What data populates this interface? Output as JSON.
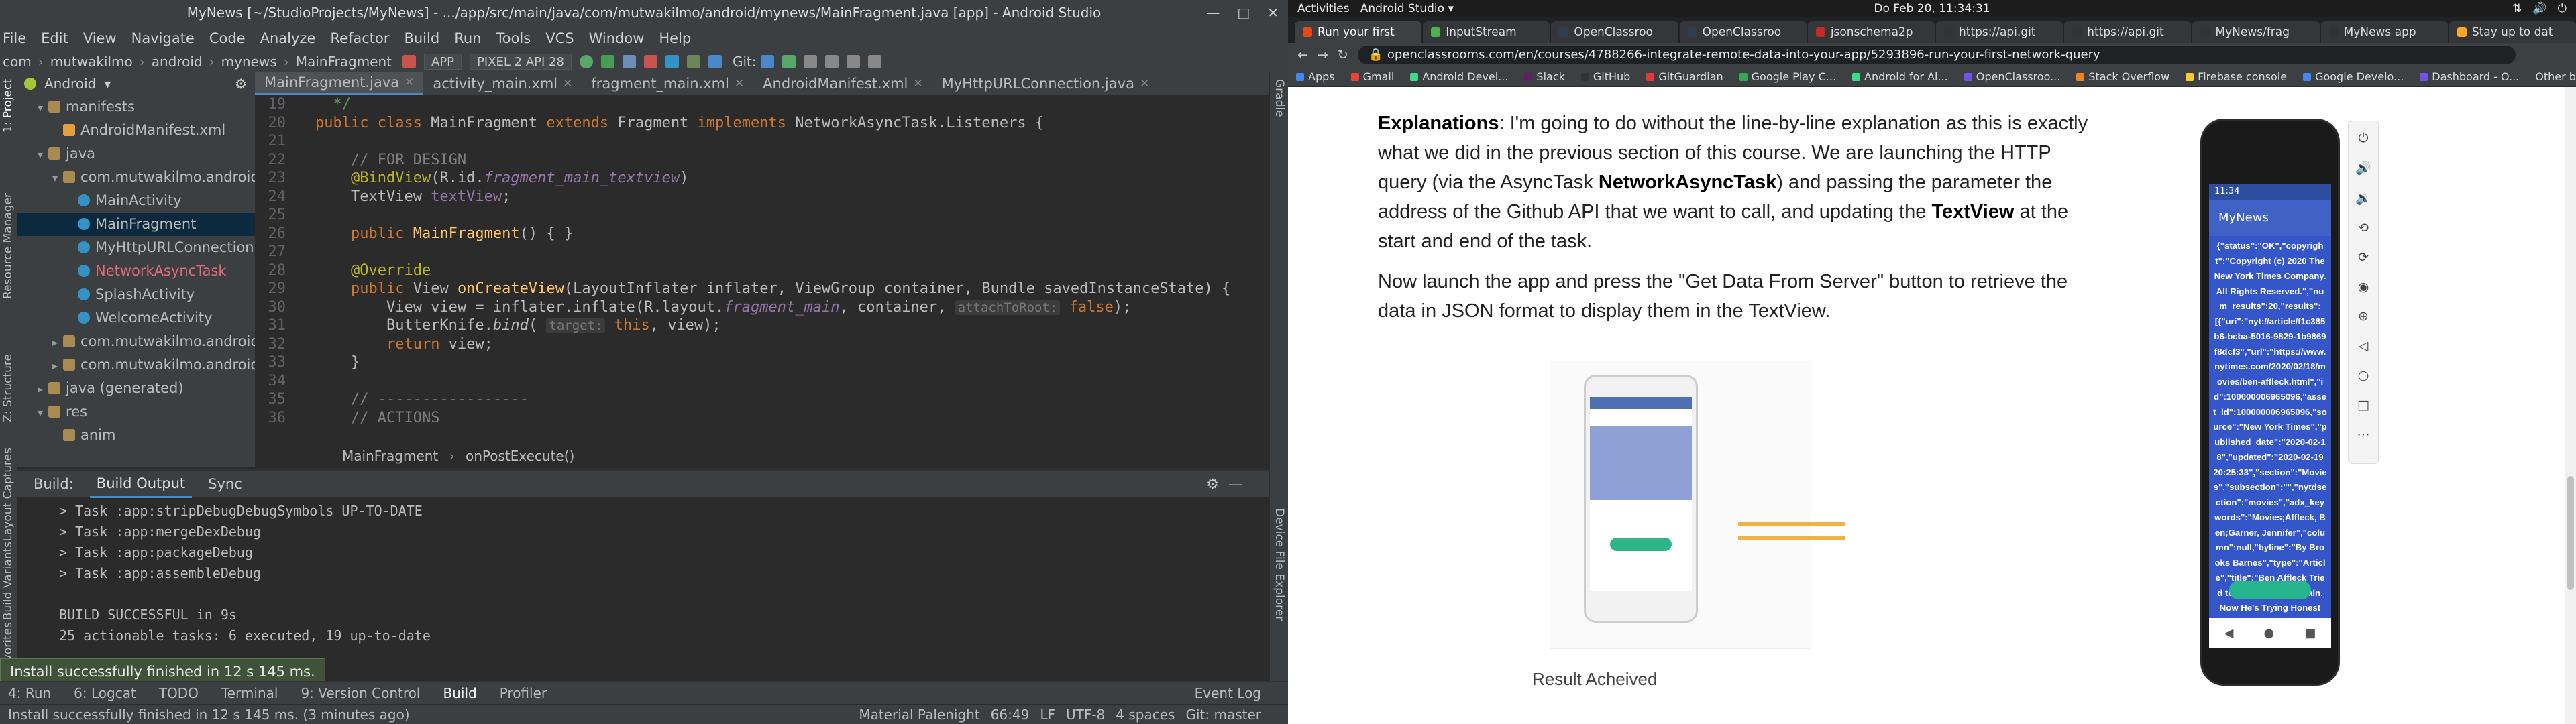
{
  "android_studio": {
    "title": "MyNews [~/StudioProjects/MyNews] - .../app/src/main/java/com/mutwakilmo/android/mynews/MainFragment.java [app] - Android Studio",
    "menu": [
      "File",
      "Edit",
      "View",
      "Navigate",
      "Code",
      "Analyze",
      "Refactor",
      "Build",
      "Run",
      "Tools",
      "VCS",
      "Window",
      "Help"
    ],
    "nav": {
      "crumbs": [
        "com",
        "mutwakilmo",
        "android",
        "mynews",
        "MainFragment"
      ],
      "config": "APP",
      "device": "PIXEL 2 API 28",
      "git": "Git:"
    },
    "project": {
      "label": "Android",
      "rows": [
        {
          "label": "manifests",
          "kind": "folder",
          "indent": 1,
          "arrow": "▾"
        },
        {
          "label": "AndroidManifest.xml",
          "kind": "xml",
          "indent": 2,
          "arrow": ""
        },
        {
          "label": "java",
          "kind": "folder",
          "indent": 1,
          "arrow": "▾"
        },
        {
          "label": "com.mutwakilmo.android",
          "kind": "folder",
          "indent": 2,
          "arrow": "▾"
        },
        {
          "label": "MainActivity",
          "kind": "cls",
          "indent": 3,
          "arrow": ""
        },
        {
          "label": "MainFragment",
          "kind": "cls",
          "indent": 3,
          "arrow": "",
          "selected": true
        },
        {
          "label": "MyHttpURLConnection",
          "kind": "cls",
          "indent": 3,
          "arrow": ""
        },
        {
          "label": "NetworkAsyncTask",
          "kind": "cls",
          "indent": 3,
          "arrow": "",
          "red": true
        },
        {
          "label": "SplashActivity",
          "kind": "cls",
          "indent": 3,
          "arrow": ""
        },
        {
          "label": "WelcomeActivity",
          "kind": "cls",
          "indent": 3,
          "arrow": ""
        },
        {
          "label": "com.mutwakilmo.android",
          "kind": "folder",
          "indent": 2,
          "arrow": "▸"
        },
        {
          "label": "com.mutwakilmo.android",
          "kind": "folder",
          "indent": 2,
          "arrow": "▸"
        },
        {
          "label": "java (generated)",
          "kind": "folder",
          "indent": 1,
          "arrow": "▸"
        },
        {
          "label": "res",
          "kind": "folder",
          "indent": 1,
          "arrow": "▾"
        },
        {
          "label": "anim",
          "kind": "folder",
          "indent": 2,
          "arrow": ""
        }
      ]
    },
    "tabs": [
      "MainFragment.java",
      "activity_main.xml",
      "fragment_main.xml",
      "AndroidManifest.xml",
      "MyHttpURLConnection.java"
    ],
    "code": [
      {
        "n": "19",
        "html": "<span class='cm'>  */</span>"
      },
      {
        "n": "20",
        "html": "<span class='kw'>public class </span>MainFragment <span class='kw'>extends </span>Fragment <span class='kw'>implements </span>NetworkAsyncTask.Listeners {"
      },
      {
        "n": "21",
        "html": ""
      },
      {
        "n": "22",
        "html": "    <span class='cm2'>// FOR DESIGN</span>"
      },
      {
        "n": "23",
        "html": "    <span class='an'>@BindView</span>(R.id.<span class='fd'>fragment_main_textview</span>)"
      },
      {
        "n": "24",
        "html": "    TextView <span class='fd' style='font-style:normal'>textView</span>;"
      },
      {
        "n": "25",
        "html": ""
      },
      {
        "n": "26",
        "html": "    <span class='kw'>public </span><span class='fn'>MainFragment</span>() { }"
      },
      {
        "n": "27",
        "html": ""
      },
      {
        "n": "28",
        "html": "    <span class='an'>@Override</span>"
      },
      {
        "n": "29",
        "html": "    <span class='kw'>public </span>View <span class='fn'>onCreateView</span>(LayoutInflater inflater, ViewGroup container, Bundle savedInstanceState) {"
      },
      {
        "n": "30",
        "html": "        View view = inflater.inflate(R.layout.<span class='fd'>fragment_main</span>, container, <span class='hint'>attachToRoot:</span> <span class='kw'>false</span>);"
      },
      {
        "n": "31",
        "html": "        ButterKnife.<span style='font-style:italic'>bind</span>( <span class='hint'>target:</span> <span class='kw'>this</span>, view);"
      },
      {
        "n": "32",
        "html": "        <span class='kw'>return </span>view;"
      },
      {
        "n": "33",
        "html": "    }"
      },
      {
        "n": "34",
        "html": ""
      },
      {
        "n": "35",
        "html": "    <span class='cm2'>// -----------------</span>"
      },
      {
        "n": "36",
        "html": "    <span class='cm2'>// ACTIONS</span>"
      }
    ],
    "breadcrumb": [
      "MainFragment",
      "onPostExecute()"
    ],
    "build": {
      "tabs": [
        "Build:",
        "Build Output",
        "Sync"
      ],
      "lines": [
        "> Task :app:stripDebugDebugSymbols UP-TO-DATE",
        "> Task :app:mergeDexDebug",
        "> Task :app:packageDebug",
        "> Task :app:assembleDebug",
        "",
        "BUILD SUCCESSFUL in 9s",
        "25 actionable tasks: 6 executed, 19 up-to-date"
      ]
    },
    "toast": "Install successfully finished in 12 s 145 ms.",
    "bottom_tools": [
      "4: Run",
      "6: Logcat",
      "TODO",
      "Terminal",
      "9: Version Control",
      "Build",
      "Profiler"
    ],
    "bottom_right": "Event Log",
    "status": "Install successfully finished in 12 s 145 ms. (3 minutes ago)",
    "status_right": [
      "Material Palenight",
      "66:49",
      "LF",
      "UTF-8",
      "4 spaces",
      "Git: master"
    ],
    "left_labels": [
      "1: Project",
      "Resource Manager",
      "Z: Structure",
      "Layout Captures",
      "Build Variants",
      "2: Favorites"
    ],
    "right_labels": [
      "Gradle",
      "Device File Explorer"
    ]
  },
  "desktop": {
    "activities": "Activities",
    "app": "Android Studio ▾",
    "clock": "Do Feb 20, 11:34:31"
  },
  "browser": {
    "tabs": [
      "Run your first",
      "InputStream",
      "OpenClassroo",
      "OpenClassroo",
      "jsonschema2p",
      "https://api.git",
      "https://api.git",
      "MyNews/frag",
      "MyNews app",
      "Stay up to dat"
    ],
    "url": "openclassrooms.com/en/courses/4788266-integrate-remote-data-into-your-app/5293896-run-your-first-network-query",
    "bookmarks": [
      "Apps",
      "Gmail",
      "Android Devel...",
      "Slack",
      "GitHub",
      "GitGuardian",
      "Google Play C...",
      "Android for Al...",
      "OpenClassroo...",
      "Stack Overflow",
      "Firebase console",
      "Google Develo...",
      "Dashboard - O..."
    ],
    "other_bookmarks": "Other bookmarks",
    "article": {
      "p1_bold": "Explanations",
      "p1_a": ": I'm going to do without the line-by-line explanation as this is exactly what we did in the previous section of this course. We are launching the HTTP query (via the AsyncTask ",
      "p1_bold2": "NetworkAsyncTask",
      "p1_b": ") and passing the parameter the address of the Github API that we want to call, and updating the ",
      "p1_bold3": "TextView",
      "p1_c": " at the start and end of the task.",
      "p2": "Now launch the app and press the \"Get Data From Server\" button to retrieve the data in JSON format to display them in the TextView.",
      "caption": "Result Acheived"
    }
  },
  "emulator": {
    "time": "11:34",
    "app_title": "MyNews",
    "json": "{\"status\":\"OK\",\"copyright\":\"Copyright (c) 2020 The New York Times Company.  All Rights Reserved.\",\"num_results\":20,\"results\":[{\"uri\":\"nyt://article/f1c385b6-bcba-5016-9829-1b9869f8dcf3\",\"url\":\"https://www.nytimes.com/2020/02/18/movies/ben-affleck.html\",\"id\":100000006965096,\"asset_id\":100000006965096,\"source\":\"New York Times\",\"published_date\":\"2020-02-18\",\"updated\":\"2020-02-19 20:25:33\",\"section\":\"Movies\",\"subsection\":\"\",\"nytdsection\":\"movies\",\"adx_keywords\":\"Movies;Affleck, Ben;Garner, Jennifer\",\"column\":null,\"byline\":\"By Brooks Barnes\",\"type\":\"Article\",\"title\":\"Ben Affleck Tried to Drink Away the Pain. Now He's Trying Honesty.\",\"abstract\":\"The actor speaks frankly about everything from his addictive behavior and his divorce to why he lied about that back tattoo.\",\"des_facet\":[\"Movies\"],\"org_facet\":[],\"per_facet\":[\"Affleck, Ben\",\"Garner, Jennifer\"],\"geo_facet\":[],\"media\":[{\"type\":\"image\",\"subtype\":\"photo\",\"caption\":\"Ben Affleck said of his public relapse last year: \\\"I wish it didn't happen. I really"
  },
  "colors": {
    "accent": "#4a88c7",
    "toast": "#3e5337",
    "emu_bg": "#3456c8"
  }
}
